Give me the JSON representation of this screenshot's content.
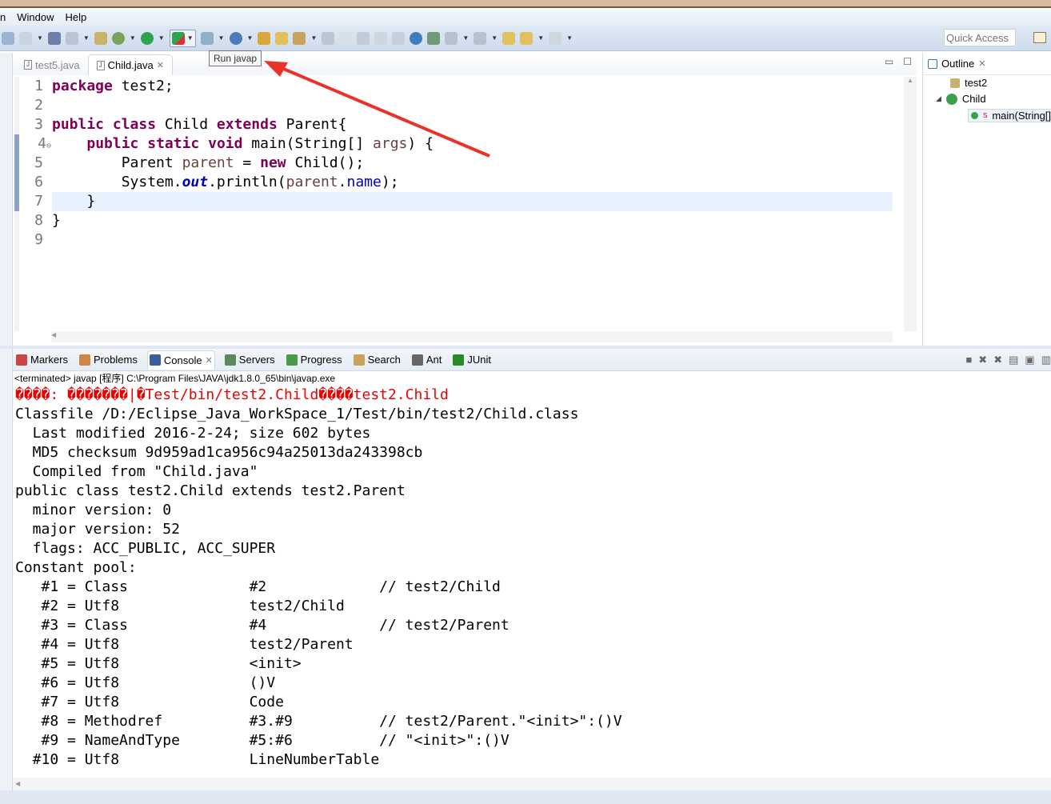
{
  "menu": {
    "items": [
      "n",
      "Window",
      "Help"
    ]
  },
  "toolbar": {
    "quick_access_placeholder": "Quick Access",
    "tooltip": "Run javap"
  },
  "annotation": {
    "arrow_color": "#e8322a"
  },
  "editor": {
    "tabs": [
      {
        "label": "test5.java",
        "active": false
      },
      {
        "label": "Child.java",
        "active": true
      }
    ],
    "line_numbers": [
      "1",
      "2",
      "3",
      "4",
      "5",
      "6",
      "7",
      "8",
      "9"
    ],
    "fold_marker": "⊖",
    "current_line": 7,
    "code": [
      [
        [
          "package",
          "kw"
        ],
        [
          " test2;",
          ""
        ]
      ],
      [],
      [
        [
          "public",
          "kw"
        ],
        [
          " ",
          ""
        ],
        [
          "class",
          "kw"
        ],
        [
          " Child ",
          ""
        ],
        [
          "extends",
          "kw"
        ],
        [
          " Parent{",
          ""
        ]
      ],
      [
        [
          "    ",
          ""
        ],
        [
          "public",
          "kw"
        ],
        [
          " ",
          ""
        ],
        [
          "static",
          "kw"
        ],
        [
          " ",
          ""
        ],
        [
          "void",
          "kw"
        ],
        [
          " main(String[] ",
          ""
        ],
        [
          "args",
          "var"
        ],
        [
          ") {",
          ""
        ]
      ],
      [
        [
          "        Parent ",
          ""
        ],
        [
          "parent",
          "var"
        ],
        [
          " = ",
          ""
        ],
        [
          "new",
          "kw"
        ],
        [
          " Child();",
          ""
        ]
      ],
      [
        [
          "        System.",
          ""
        ],
        [
          "out",
          "it"
        ],
        [
          ".println(",
          ""
        ],
        [
          "parent",
          "var"
        ],
        [
          ".",
          ""
        ],
        [
          "name",
          "fld"
        ],
        [
          ");",
          ""
        ]
      ],
      [
        [
          "    }",
          ""
        ]
      ],
      [
        [
          "}",
          ""
        ]
      ],
      []
    ]
  },
  "outline": {
    "tab_label": "Outline",
    "items": [
      {
        "label": "test2",
        "icon": "package-icon"
      },
      {
        "label": "Child",
        "icon": "class-icon"
      },
      {
        "label": "main(String[])",
        "icon": "method-icon",
        "modifier": "S"
      }
    ]
  },
  "console": {
    "tabs": [
      "Markers",
      "Problems",
      "Console",
      "Servers",
      "Progress",
      "Search",
      "Ant",
      "JUnit"
    ],
    "active_tab": "Console",
    "status": "<terminated> javap [程序] C:\\Program Files\\JAVA\\jdk1.8.0_65\\bin\\javap.exe",
    "error_line": "����: �������|�Test/bin/test2.Child����test2.Child",
    "lines": [
      "Classfile /D:/Eclipse_Java_WorkSpace_1/Test/bin/test2/Child.class",
      "  Last modified 2016-2-24; size 602 bytes",
      "  MD5 checksum 9d959ad1ca956c94a25013da243398cb",
      "  Compiled from \"Child.java\"",
      "public class test2.Child extends test2.Parent",
      "  minor version: 0",
      "  major version: 52",
      "  flags: ACC_PUBLIC, ACC_SUPER",
      "Constant pool:",
      "   #1 = Class              #2             // test2/Child",
      "   #2 = Utf8               test2/Child",
      "   #3 = Class              #4             // test2/Parent",
      "   #4 = Utf8               test2/Parent",
      "   #5 = Utf8               <init>",
      "   #6 = Utf8               ()V",
      "   #7 = Utf8               Code",
      "   #8 = Methodref          #3.#9          // test2/Parent.\"<init>\":()V",
      "   #9 = NameAndType        #5:#6          // \"<init>\":()V",
      "  #10 = Utf8               LineNumberTable"
    ]
  }
}
